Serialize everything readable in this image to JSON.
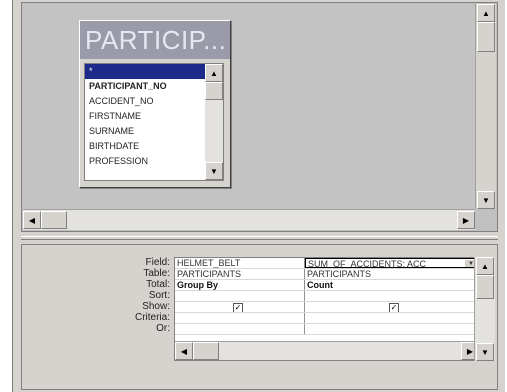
{
  "table_box": {
    "title": "PARTICIP...",
    "fields": [
      {
        "label": "*",
        "selected": true,
        "bold": false
      },
      {
        "label": "PARTICIPANT_NO",
        "selected": false,
        "bold": true
      },
      {
        "label": "ACCIDENT_NO",
        "selected": false,
        "bold": false
      },
      {
        "label": "FIRSTNAME",
        "selected": false,
        "bold": false
      },
      {
        "label": "SURNAME",
        "selected": false,
        "bold": false
      },
      {
        "label": "BIRTHDATE",
        "selected": false,
        "bold": false
      },
      {
        "label": "PROFESSION",
        "selected": false,
        "bold": false
      }
    ]
  },
  "grid": {
    "row_labels": {
      "field": "Field:",
      "table": "Table:",
      "total": "Total:",
      "sort": "Sort:",
      "show": "Show:",
      "criteria": "Criteria:",
      "or": "Or:"
    },
    "columns": [
      {
        "field": "HELMET_BELT",
        "table": "PARTICIPANTS",
        "total": "Group By",
        "sort": "",
        "show": true
      },
      {
        "field": "SUM_OF_ACCIDENTS: ACC",
        "table": "PARTICIPANTS",
        "total": "Count",
        "sort": "",
        "show": true
      }
    ]
  },
  "icons": {
    "scroll_up": "up-arrow-icon",
    "scroll_down": "down-arrow-icon",
    "scroll_left": "left-arrow-icon",
    "scroll_right": "right-arrow-icon",
    "checkbox": "checkmark-icon",
    "dropdown": "dropdown-arrow-icon"
  },
  "glyphs": {
    "up": "▲",
    "down": "▼",
    "left": "◀",
    "right": "▶",
    "check": "✓"
  }
}
